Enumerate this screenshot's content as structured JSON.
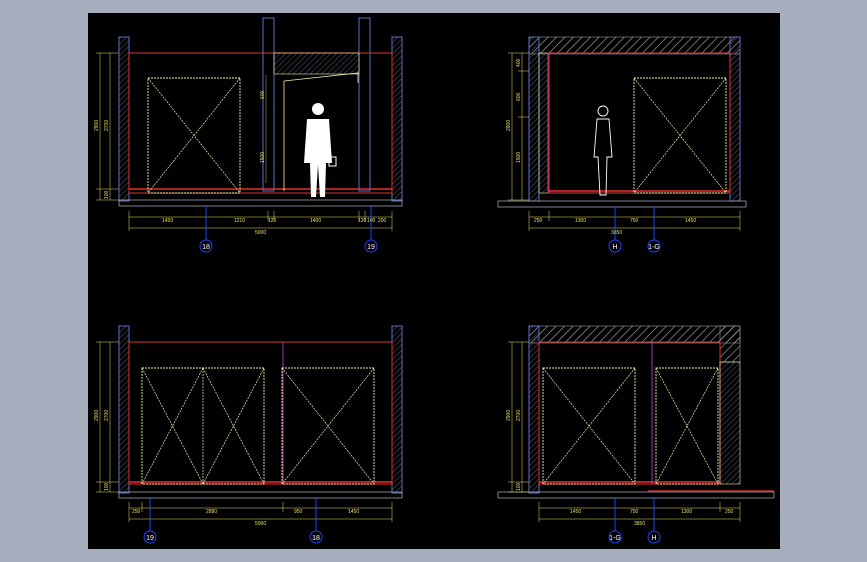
{
  "colors": {
    "background_frame": "#a6adbd",
    "drawing_bg": "#000000",
    "wall_outline": "#5a72c8",
    "room_outline": "#e23030",
    "door_frame": "#f0f0a8",
    "dimension": "#e8e060",
    "axis_bubble": "#2040ff",
    "magenta_line": "#d040d0",
    "hatch": "#9a9a9a"
  },
  "elevations": [
    {
      "id": "elevation-1",
      "vertical_dims": [
        "2900",
        "2700",
        "100"
      ],
      "inner_dims": [
        "600",
        "1500"
      ],
      "horizontal_dims": [
        "1450",
        "1210",
        "120",
        "1400",
        "120",
        "100",
        "200"
      ],
      "total": "5000",
      "axis_labels": [
        "18",
        "19"
      ]
    },
    {
      "id": "elevation-2",
      "vertical_dims": [
        "2900",
        "400",
        "600",
        "1500"
      ],
      "horizontal_dims": [
        "250",
        "1300",
        "750",
        "1450"
      ],
      "total": "3850",
      "axis_labels": [
        "H",
        "1-G"
      ]
    },
    {
      "id": "elevation-3",
      "vertical_dims": [
        "2900",
        "2700",
        "100"
      ],
      "horizontal_dims": [
        "250",
        "2880",
        "950",
        "1450"
      ],
      "total": "5000",
      "axis_labels": [
        "19",
        "18"
      ]
    },
    {
      "id": "elevation-4",
      "vertical_dims": [
        "2900",
        "2700",
        "100"
      ],
      "horizontal_dims": [
        "1450",
        "750",
        "1300",
        "250"
      ],
      "total": "3850",
      "axis_labels": [
        "1-G",
        "H"
      ]
    }
  ]
}
